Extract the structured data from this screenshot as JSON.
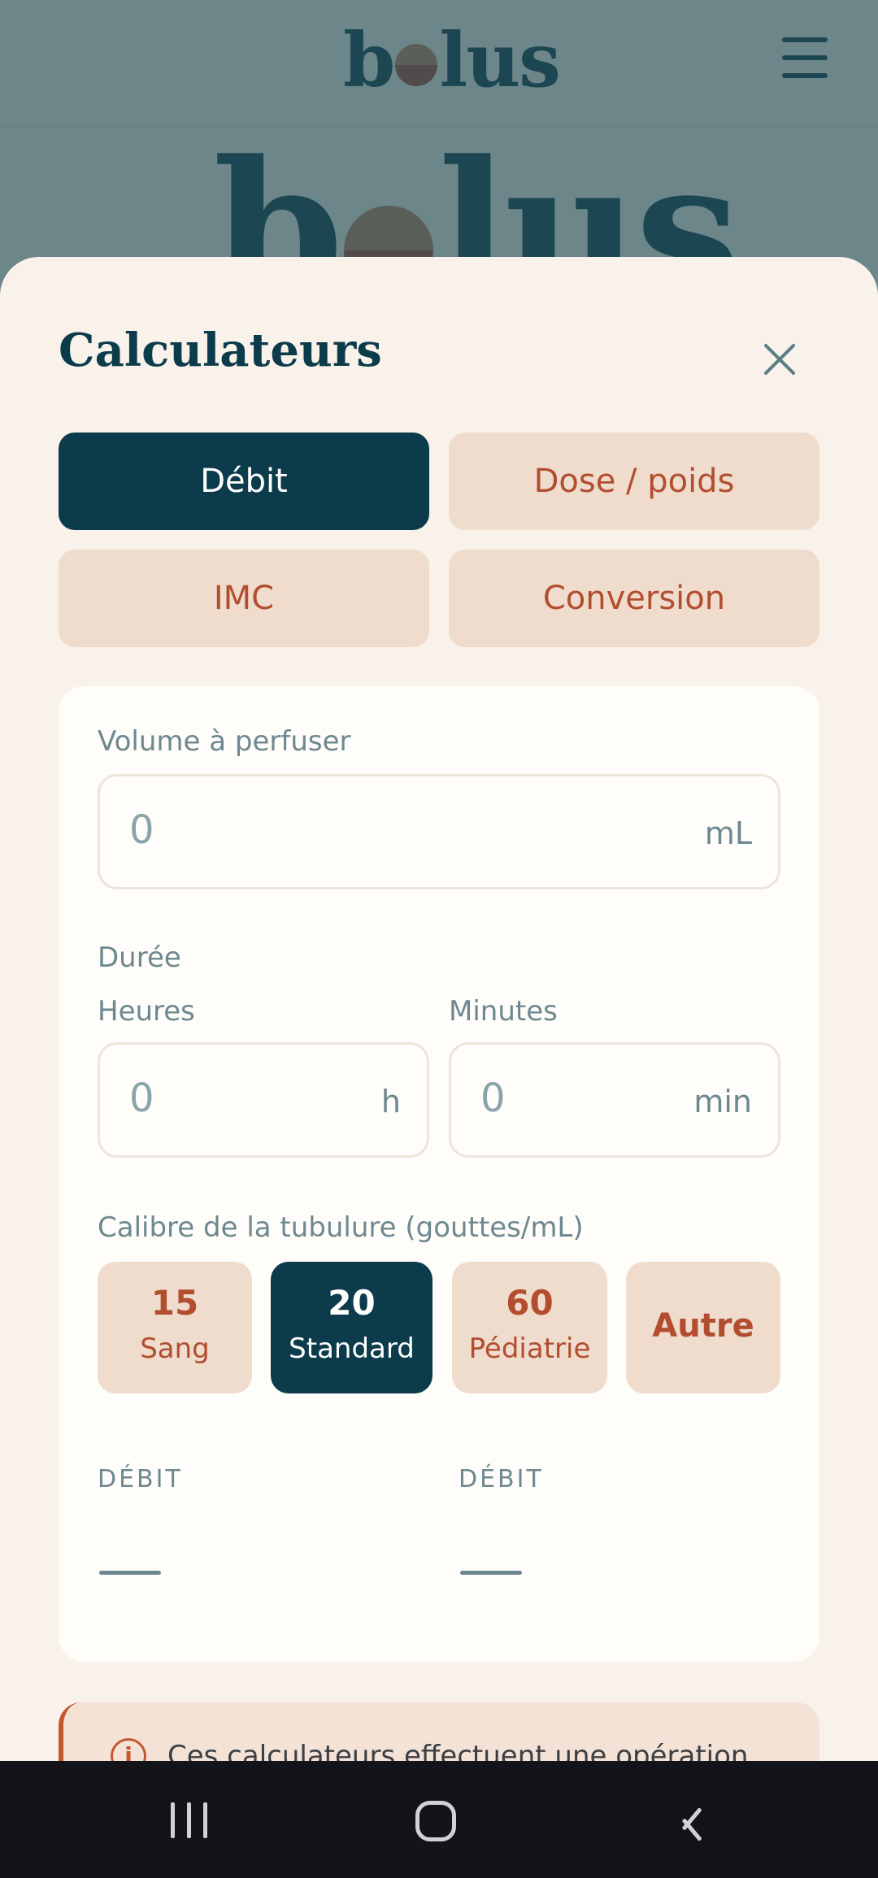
{
  "app": {
    "logo_text_before": "b",
    "logo_text_after": "lus",
    "logo_icon": "half-circle-o-icon",
    "menu_icon": "hamburger-menu-icon"
  },
  "sheet": {
    "title": "Calculateurs",
    "close_icon": "close-icon",
    "tabs": [
      {
        "label": "Débit",
        "active": true
      },
      {
        "label": "Dose / poids",
        "active": false
      },
      {
        "label": "IMC",
        "active": false
      },
      {
        "label": "Conversion",
        "active": false
      }
    ]
  },
  "form": {
    "volume": {
      "label": "Volume à perfuser",
      "value": "0",
      "unit": "mL"
    },
    "duration": {
      "label": "Durée",
      "hours": {
        "label": "Heures",
        "value": "0",
        "unit": "h"
      },
      "minutes": {
        "label": "Minutes",
        "value": "0",
        "unit": "min"
      }
    },
    "gauge": {
      "label": "Calibre de la tubulure (gouttes/mL)",
      "options": [
        {
          "value": "15",
          "name": "Sang",
          "active": false
        },
        {
          "value": "20",
          "name": "Standard",
          "active": true
        },
        {
          "value": "60",
          "name": "Pédiatrie",
          "active": false
        },
        {
          "value": "",
          "name": "Autre",
          "active": false
        }
      ]
    },
    "results": [
      {
        "label": "DÉBIT",
        "value": "—"
      },
      {
        "label": "DÉBIT",
        "value": "—"
      }
    ]
  },
  "notice": {
    "icon": "info-icon",
    "text": "Ces calculateurs effectuent une opération"
  },
  "navbar": {
    "recents_icon": "recents-icon",
    "home_icon": "home-icon",
    "back_icon": "back-icon"
  },
  "colors": {
    "primary": "#0c3b4b",
    "accent": "#b34d2f",
    "tab_bg": "#efdccd",
    "sheet_bg": "#f8f2ea",
    "card_bg": "#fffdf9"
  }
}
